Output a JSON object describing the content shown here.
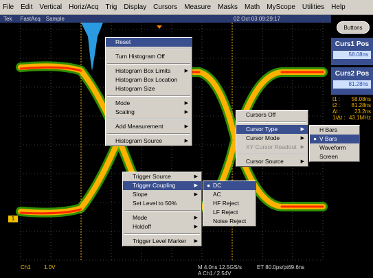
{
  "menubar": [
    "File",
    "Edit",
    "Vertical",
    "Horiz/Acq",
    "Trig",
    "Display",
    "Cursors",
    "Measure",
    "Masks",
    "Math",
    "MyScope",
    "Utilities",
    "Help"
  ],
  "status": {
    "brand": "Tek",
    "acq": "FastAcq",
    "mode": "Sample",
    "datetime": "02 Oct 03 09:29:17"
  },
  "right": {
    "buttons_label": "Buttons",
    "curs1_title": "Curs1 Pos",
    "curs1_value": "58.08ns",
    "curs2_title": "Curs2 Pos",
    "curs2_value": "81.28ns",
    "readout": [
      [
        "t1 :",
        "58.08ns"
      ],
      [
        "t2 :",
        "81.28ns"
      ],
      [
        "Δt :",
        "23.2ns"
      ],
      [
        "1/Δt :",
        "43.1MHz"
      ]
    ]
  },
  "bottom": {
    "ch": "Ch1",
    "volts": "1.0V",
    "timebase": "M 4.0ns 12.5GS/s",
    "et": "ET 80.0ps/pt69.6ns",
    "trig": "A  Ch1  ⁄  2.54V"
  },
  "ch_marker": "1",
  "menus": {
    "histogram": [
      "Reset",
      "Turn Histogram Off",
      "Histogram Box Limits",
      "Histogram Box Location",
      "Histogram Size",
      "Mode",
      "Scaling",
      "Add Measurement",
      "Histogram Source"
    ],
    "cursor": [
      "Cursors Off",
      "Cursor Type",
      "Cursor Mode",
      "XY Cursor Readout",
      "Cursor Source"
    ],
    "cursor_type": [
      "H Bars",
      "V Bars",
      "Waveform",
      "Screen"
    ],
    "trigger": [
      "Trigger Source",
      "Trigger Coupling",
      "Slope",
      "Set Level to 50%",
      "Mode",
      "Holdoff",
      "Trigger Level Marker"
    ],
    "coupling": [
      "DC",
      "AC",
      "HF Reject",
      "LF Reject",
      "Noise Reject"
    ]
  },
  "colors": {
    "screen": "#000000",
    "highlight": "#3a4f8f",
    "menu": "#d4d0c8",
    "trace_hot": "#ff3000",
    "trace_mid": "#ffb000",
    "trace_cool": "#40c000",
    "histogram": "#2a9be0",
    "cursor": "#f0b000"
  }
}
